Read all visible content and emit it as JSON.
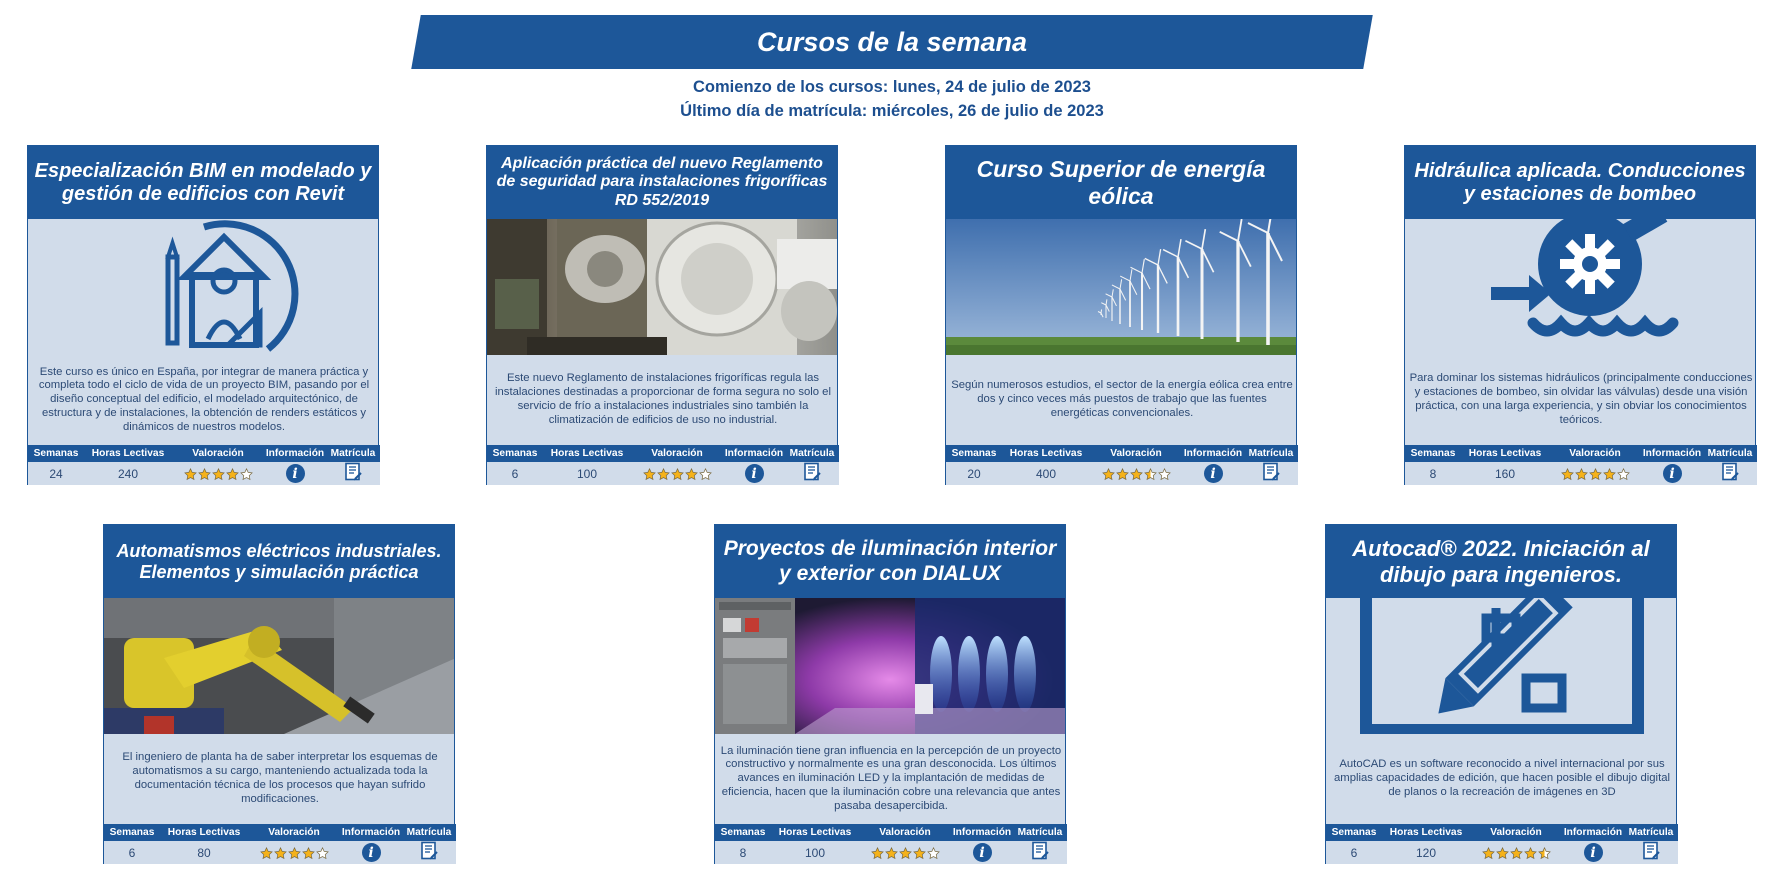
{
  "header": {
    "title": "Cursos de la semana",
    "start_line": "Comienzo de los cursos: lunes, 24 de julio de 2023",
    "deadline_line": "Último día de matrícula: miércoles, 26 de julio de 2023"
  },
  "table_headers": {
    "weeks": "Semanas",
    "hours": "Horas Lectivas",
    "rating": "Valoración",
    "info": "Información",
    "enroll": "Matrícula"
  },
  "courses": [
    {
      "title": "Especialización BIM en modelado y gestión de edificios con Revit",
      "media": "bim-house-pencil-icon",
      "description": "Este curso es único en España, por integrar de manera práctica y completa todo el ciclo de vida de un proyecto BIM, pasando por el diseño conceptual del edificio, el modelado arquitectónico, de estructura y de instalaciones, la obtención de renders estáticos y dinámicos de nuestros modelos.",
      "weeks": "24",
      "hours": "240",
      "rating": 4
    },
    {
      "title": "Aplicación práctica del nuevo Reglamento de seguridad para instalaciones frigoríficas RD 552/2019",
      "media": "refrigeration-plant-photo",
      "description": "Este nuevo Reglamento de instalaciones frigoríficas regula las instalaciones destinadas a proporcionar de forma segura no solo el servicio de frío a instalaciones industriales sino también la climatización de edificios de uso no industrial.",
      "weeks": "6",
      "hours": "100",
      "rating": 4
    },
    {
      "title": "Curso Superior de energía eólica",
      "media": "wind-farm-photo",
      "description": "Según numerosos estudios, el sector de la energía eólica crea entre dos y cinco veces más puestos de trabajo que las fuentes energéticas convencionales.",
      "weeks": "20",
      "hours": "400",
      "rating": 3.5
    },
    {
      "title": "Hidráulica aplicada. Conducciones y estaciones de bombeo",
      "media": "pump-gear-icon",
      "description": "Para dominar los sistemas hidráulicos (principalmente conducciones y estaciones de bombeo, sin olvidar las válvulas) desde una visión práctica, con una larga experiencia, y sin obviar los conocimientos teóricos.",
      "weeks": "8",
      "hours": "160",
      "rating": 4
    },
    {
      "title": "Automatismos eléctricos industriales. Elementos y simulación práctica",
      "media": "industrial-robot-photo",
      "description": "El ingeniero de planta ha de saber interpretar los esquemas de automatismos a su cargo, manteniendo actualizada toda la documentación técnica de los procesos que hayan sufrido modificaciones.",
      "weeks": "6",
      "hours": "80",
      "rating": 4
    },
    {
      "title": "Proyectos de iluminación interior y exterior con DIALUX",
      "media": "dialux-render-photo",
      "description": "La iluminación tiene gran influencia en la percepción de un proyecto constructivo y normalmente es una gran desconocida. Los últimos avances en iluminación LED y la implantación de medidas de eficiencia, hacen que la iluminación cobre una relevancia que antes pasaba desapercibida.",
      "weeks": "8",
      "hours": "100",
      "rating": 4
    },
    {
      "title": "Autocad® 2022. Iniciación al dibujo para ingenieros.",
      "media": "cad-pencil-icon",
      "description": "AutoCAD es un software reconocido a nivel internacional por sus amplias capacidades de edición, que hacen posible el dibujo digital de planos o la recreación de imágenes en 3D",
      "weeks": "6",
      "hours": "120",
      "rating": 4.5
    }
  ],
  "colors": {
    "brand": "#1d5799",
    "card_bg": "#d1dcea",
    "star": "#f5b21a"
  }
}
